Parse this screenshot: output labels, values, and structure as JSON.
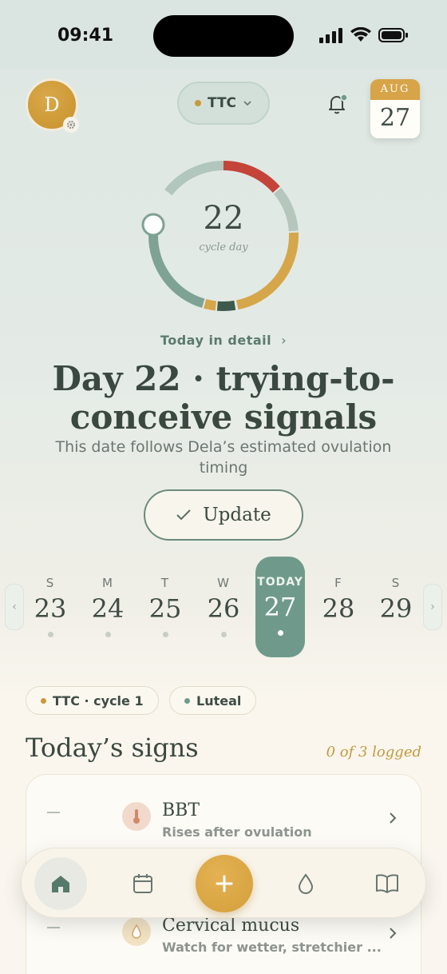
{
  "status_bar": {
    "time": "09:41"
  },
  "header": {
    "avatar_initial": "D",
    "mode_label": "TTC",
    "calendar": {
      "month": "AUG",
      "day": "27"
    }
  },
  "cycle": {
    "day": "22",
    "label": "cycle day"
  },
  "detail": {
    "link_label": "Today in detail",
    "headline": "Day 22 · trying-to-conceive signals",
    "subline": "This date follows Dela’s estimated ovulation timing",
    "update_label": "Update"
  },
  "week": [
    {
      "letter": "S",
      "num": "23",
      "today": false
    },
    {
      "letter": "M",
      "num": "24",
      "today": false
    },
    {
      "letter": "T",
      "num": "25",
      "today": false
    },
    {
      "letter": "W",
      "num": "26",
      "today": false
    },
    {
      "letter": "TODAY",
      "num": "27",
      "today": true
    },
    {
      "letter": "F",
      "num": "28",
      "today": false
    },
    {
      "letter": "S",
      "num": "29",
      "today": false
    }
  ],
  "chips": {
    "cycle": "TTC · cycle 1",
    "phase": "Luteal"
  },
  "signs": {
    "title": "Today’s signs",
    "logged": "0 of 3 logged",
    "items": [
      {
        "title": "BBT",
        "subtitle": "Rises after ovulation",
        "icon": "thermometer-icon"
      },
      {
        "title": "Cervical mucus",
        "subtitle": "Watch for wetter, stretchier ...",
        "icon": "droplet-icon"
      }
    ]
  },
  "colors": {
    "accent_green": "#6f9a8b",
    "accent_gold": "#d7a448",
    "phase_red": "#c4443a",
    "phase_sage": "#b5c7bd",
    "phase_dark": "#3e5a4c"
  },
  "tabbar": {
    "tabs": [
      "home-icon",
      "calendar-icon",
      "plus-icon",
      "droplet-icon",
      "book-icon"
    ]
  }
}
